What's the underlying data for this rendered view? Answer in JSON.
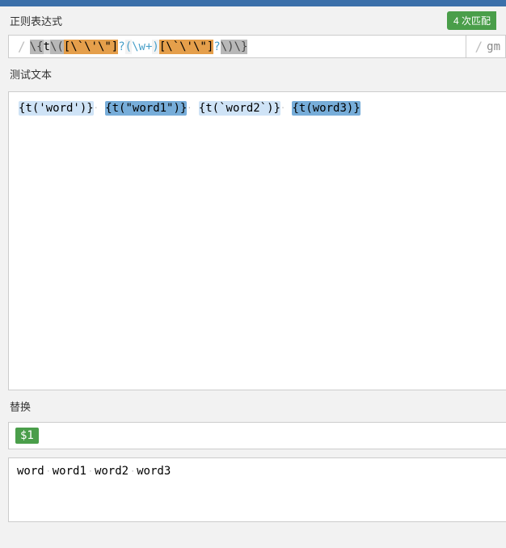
{
  "sections": {
    "regex_label": "正则表达式",
    "test_label": "测试文本",
    "subst_label": "替换"
  },
  "badge": "4 次匹配",
  "regex": {
    "slash": "/",
    "flags": "gm",
    "tokens": {
      "t1": "\\{",
      "t2": "t",
      "t3": "\\(",
      "t4": "[\\`\\'\\\"]",
      "t5": "?",
      "t6": "(",
      "t7": "\\w+",
      "t8": ")",
      "t9": "[\\`\\'\\\"]",
      "t10": "?",
      "t11": "\\)",
      "t12": "\\}"
    }
  },
  "test": {
    "m1": "{t('word')}",
    "m2": "{t(\"word1\")}",
    "m3": "{t(`word2`)}",
    "m4": "{t(word3)}"
  },
  "subst": {
    "pattern": "$1",
    "r1": "word",
    "r2": "word1",
    "r3": "word2",
    "r4": "word3"
  }
}
